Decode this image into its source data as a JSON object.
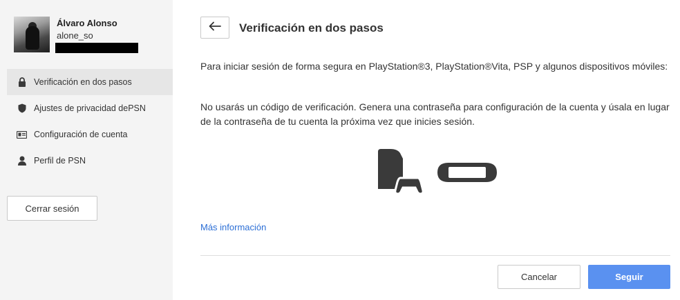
{
  "profile": {
    "name": "Álvaro Alonso",
    "online_id": "alone_so"
  },
  "sidebar": {
    "items": [
      {
        "label": "Verificación en dos pasos",
        "icon": "lock-icon",
        "active": true
      },
      {
        "label": "Ajustes de privacidad dePSN",
        "icon": "shield-icon",
        "active": false
      },
      {
        "label": "Configuración de cuenta",
        "icon": "id-card-icon",
        "active": false
      },
      {
        "label": "Perfil de PSN",
        "icon": "person-icon",
        "active": false
      }
    ],
    "logout_label": "Cerrar sesión"
  },
  "main": {
    "back_icon": "arrow-left-icon",
    "title": "Verificación en dos pasos",
    "paragraph1": "Para iniciar sesión de forma segura en PlayStation®3, PlayStation®Vita, PSP y algunos dispositivos móviles:",
    "paragraph2": "No usarás un código de verificación. Genera una contraseña para configuración de la cuenta y úsala en lugar de la contraseña de tu cuenta la próxima vez que inicies sesión.",
    "device_icons": [
      "ps3-console-icon",
      "controller-icon",
      "ps-vita-icon"
    ],
    "more_info_label": "Más información",
    "cancel_label": "Cancelar",
    "continue_label": "Seguir"
  },
  "colors": {
    "sidebar_bg": "#f4f4f4",
    "active_item_bg": "#e6e6e6",
    "link": "#2c6fd6",
    "primary_button": "#5a91f0",
    "icon": "#3a3a3a"
  }
}
